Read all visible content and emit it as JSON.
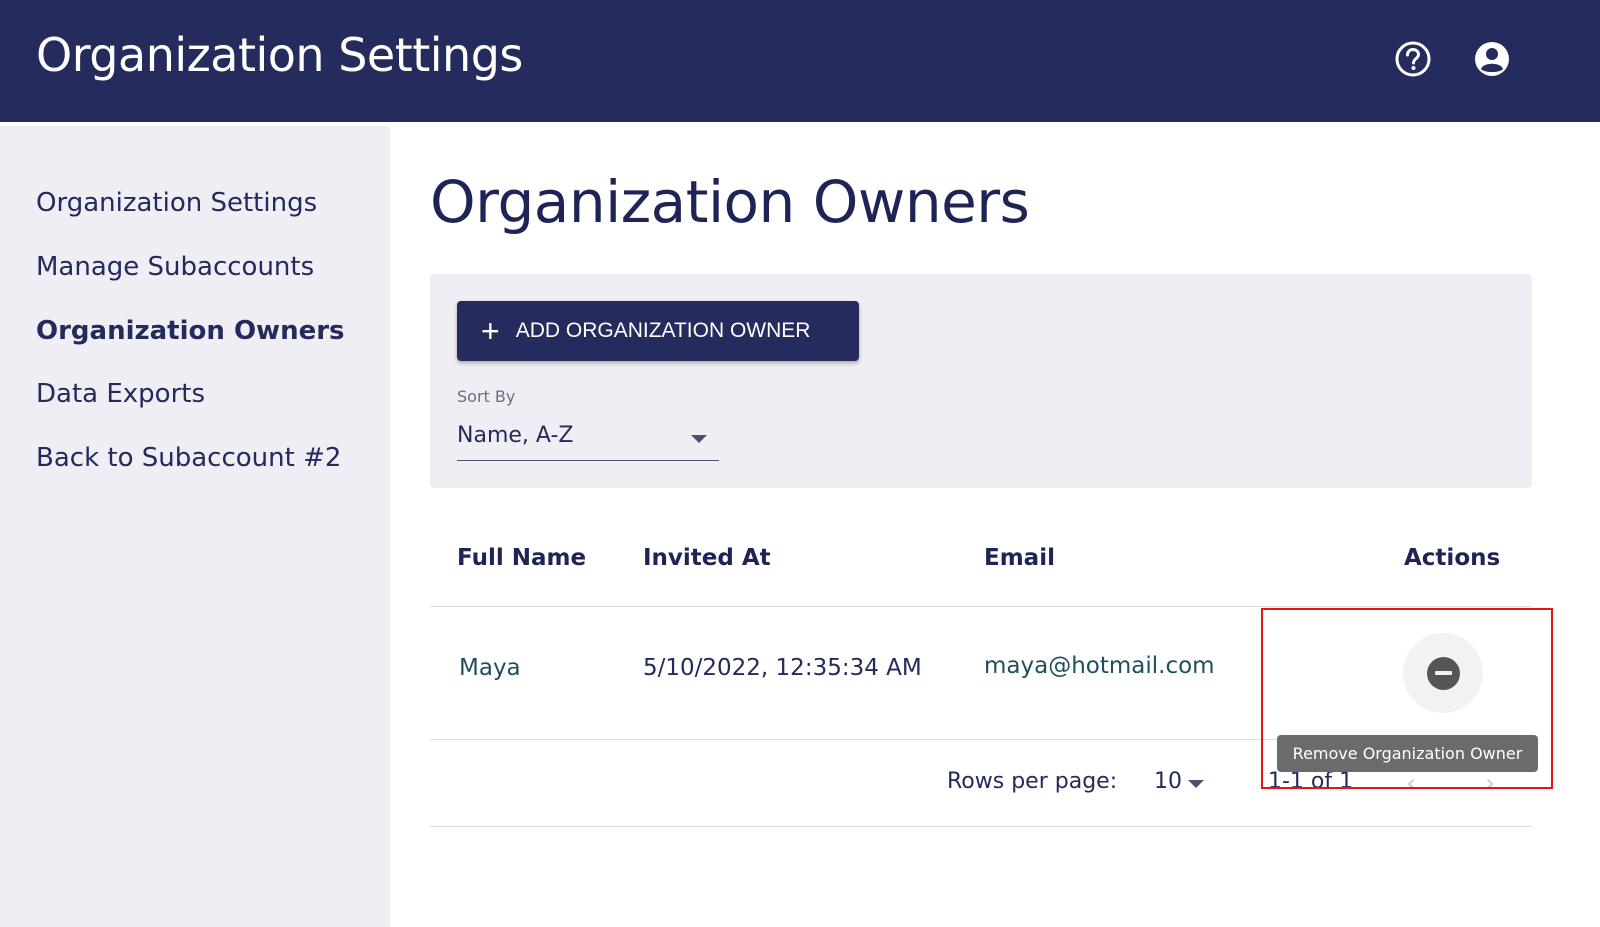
{
  "header": {
    "title": "Organization Settings",
    "help_icon": "help-circle-icon",
    "account_icon": "account-circle-icon",
    "background_color": "#252b5c"
  },
  "sidebar": {
    "items": [
      {
        "label": "Organization Settings",
        "active": false
      },
      {
        "label": "Manage Subaccounts",
        "active": false
      },
      {
        "label": "Organization Owners",
        "active": true
      },
      {
        "label": "Data Exports",
        "active": false
      },
      {
        "label": "Back to Subaccount #2",
        "active": false
      }
    ]
  },
  "main": {
    "title": "Organization Owners",
    "add_button": {
      "icon": "plus-icon",
      "label": "ADD ORGANIZATION OWNER"
    },
    "sort": {
      "label": "Sort By",
      "value": "Name, A-Z"
    }
  },
  "table": {
    "columns": [
      "Full Name",
      "Invited At",
      "Email",
      "Actions"
    ],
    "rows": [
      {
        "full_name": "Maya",
        "invited_at": "5/10/2022, 12:35:34 AM",
        "email": "maya@hotmail.com",
        "action_icon": "remove-circle-icon"
      }
    ],
    "tooltip": "Remove Organization Owner"
  },
  "pagination": {
    "rows_per_page_label": "Rows per page:",
    "rows_per_page": "10",
    "range": "1-1 of 1",
    "prev_icon": "chevron-left-icon",
    "next_icon": "chevron-right-icon"
  },
  "annotation": {
    "highlight_color": "#e8141c"
  }
}
